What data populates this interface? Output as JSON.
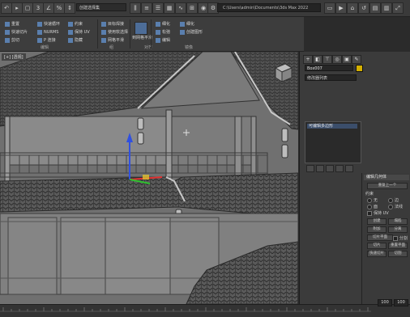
{
  "toolbar": {
    "selection_filter": "创建选择集",
    "path": "C:\\Users\\admin\\Documents\\3ds Max 2022",
    "snap_angle": "3",
    "icons": [
      "undo-icon",
      "redo-icon",
      "link-icon",
      "unlink-icon",
      "bind-icon",
      "select-filter-icon",
      "select-icon",
      "select-name-icon",
      "rect-select-icon",
      "window-crossing-icon",
      "move-icon",
      "rotate-icon",
      "scale-icon",
      "snap-3d-icon",
      "angle-snap-icon",
      "percent-snap-icon",
      "spinner-snap-icon",
      "named-sel-icon",
      "mirror-icon",
      "align-icon",
      "layer-icon",
      "graphite-icon",
      "curve-editor-icon",
      "schematic-icon",
      "material-icon",
      "render-setup-icon",
      "render-frame-icon",
      "render-icon",
      "project-icon"
    ]
  },
  "ribbon": {
    "groups": [
      "编辑",
      "组",
      "对齐",
      "镜像"
    ],
    "items": {
      "reset": "重置",
      "quick_slice": "快速切片",
      "quick_loop": "快速循环",
      "nurms": "NURMS",
      "cut": "剪切",
      "p_connect": "P 连接",
      "shape_shift": "约束",
      "preserve_uv": "保持 UV",
      "stack_top": "到网格平滑",
      "smooth_edge": "使用软选择",
      "hide": "隐藏",
      "target_weld": "目标焊接",
      "mesh_smooth": "网格平滑",
      "tess": "细化",
      "tess2": "细化",
      "ro": "松弛",
      "ed": "编辑",
      "to_line": "创建图形"
    }
  },
  "viewport": {
    "label": "[+] [透视]",
    "axis": {
      "x": "x",
      "y": "y",
      "z": "z"
    }
  },
  "right_panel": {
    "tabs": [
      "+",
      "modify",
      "hierarchy",
      "motion",
      "display",
      "utilities"
    ],
    "object_name": "Box007",
    "modifier_list": "修改器列表",
    "stack_item": "可编辑多边形",
    "rollout_title": "编辑几何体",
    "rollout_sub": "重复上一个",
    "constraint_label": "约束",
    "radio_none": "无",
    "radio_edge": "边",
    "radio_face": "面",
    "radio_normal": "法线",
    "preserve_uv": "保持 UV",
    "create": "创建",
    "collapse": "塌陷",
    "attach": "附加",
    "detach": "分离",
    "slice_plane": "切片平面",
    "split": "分割",
    "slice": "切片",
    "reset_plane": "重置平面",
    "quick_slice": "快速切片",
    "cut": "切割"
  },
  "status": {
    "frame_left": "100",
    "frame_right": "100"
  },
  "colors": {
    "object_color": "#d4b000",
    "roof_tile": "#4a4a4a",
    "wall": "#8a8a8a",
    "axis_x": "#e03030",
    "axis_y": "#30c030",
    "axis_z": "#3050e0"
  }
}
